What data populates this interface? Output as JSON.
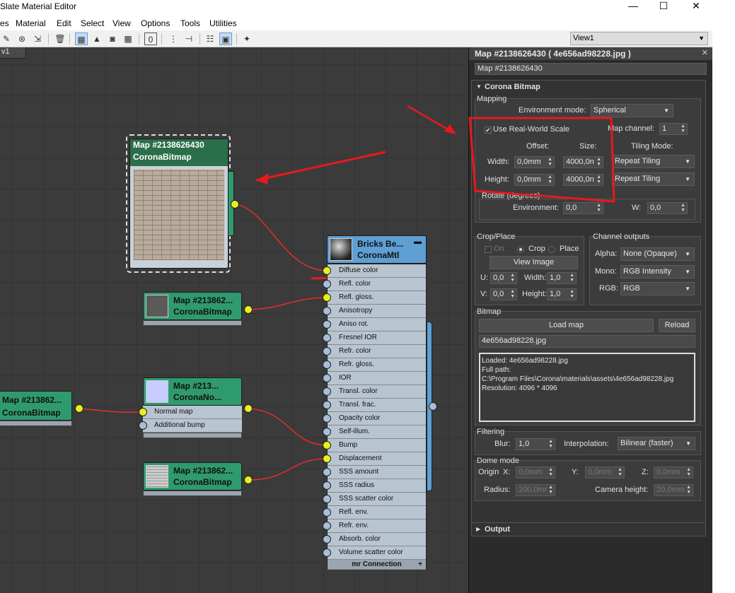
{
  "window": {
    "title": "Slate Material Editor",
    "minimize": "—",
    "maximize": "☐",
    "close": "✕"
  },
  "menu": [
    "es",
    "Material",
    "Edit",
    "Select",
    "View",
    "Options",
    "Tools",
    "Utilities"
  ],
  "toolbar": {
    "view_select": "View1"
  },
  "canvas": {
    "tab": "v1",
    "nodes": {
      "bitmap_main": {
        "title": "Map #2138626430",
        "type": "CoronaBitmap"
      },
      "bitmap_gloss": {
        "title": "Map #213862...",
        "type": "CoronaBitmap"
      },
      "bitmap_left": {
        "title": "Map #213862...",
        "type": "CoronaBitmap"
      },
      "normal": {
        "title": "Map #213...",
        "type": "CoronaNo...",
        "slots": [
          "Normal map",
          "Additional bump"
        ]
      },
      "bitmap_disp": {
        "title": "Map #213862...",
        "type": "CoronaBitmap"
      },
      "mtl": {
        "title": "Bricks Be...",
        "type": "CoronaMtl",
        "slots": [
          "Diffuse color",
          "Refl. color",
          "Refl. gloss.",
          "Anisotropy",
          "Aniso rot.",
          "Fresnel IOR",
          "Refr. color",
          "Refr. gloss.",
          "IOR",
          "Transl. color",
          "Transl. frac.",
          "Opacity color",
          "Self-illum.",
          "Bump",
          "Displacement",
          "SSS amount",
          "SSS radius",
          "SSS scatter color",
          "Refl. env.",
          "Refr. env.",
          "Absorb. color",
          "Volume scatter color"
        ],
        "footer": "mr Connection",
        "footer_plus": "+"
      }
    }
  },
  "panel": {
    "title": "Map #2138626430 ( 4e656ad98228.jpg )",
    "name_field": "Map #2138626430",
    "rollout_title": "Corona Bitmap",
    "mapping": {
      "label": "Mapping",
      "env_mode_label": "Environment mode:",
      "env_mode_value": "Spherical",
      "use_real_world": "Use Real-World Scale",
      "map_channel_label": "Map channel:",
      "map_channel_value": "1",
      "offset_hdr": "Offset:",
      "size_hdr": "Size:",
      "tiling_hdr": "Tiling Mode:",
      "width_label": "Width:",
      "width_offset": "0,0mm",
      "width_size": "4000,0n",
      "width_tiling": "Repeat Tiling",
      "height_label": "Height:",
      "height_offset": "0,0mm",
      "height_size": "4000,0n",
      "height_tiling": "Repeat Tiling",
      "rotate_label": "Rotate (degrees)",
      "environment_label": "Environment:",
      "environment_value": "0,0",
      "w_label": "W:",
      "w_value": "0,0"
    },
    "crop": {
      "label": "Crop/Place",
      "on": "On",
      "crop": "Crop",
      "place": "Place",
      "view_image": "View Image",
      "u_label": "U:",
      "u_value": "0,0",
      "width_label": "Width:",
      "width_value": "1,0",
      "v_label": "V:",
      "v_value": "0,0",
      "height_label": "Height:",
      "height_value": "1,0"
    },
    "channel": {
      "label": "Channel outputs",
      "alpha_label": "Alpha:",
      "alpha_value": "None (Opaque)",
      "mono_label": "Mono:",
      "mono_value": "RGB Intensity",
      "rgb_label": "RGB:",
      "rgb_value": "RGB"
    },
    "bitmap": {
      "label": "Bitmap",
      "load_map": "Load map",
      "reload": "Reload",
      "filename": "4e656ad98228.jpg",
      "info_loaded": "Loaded: 4e656ad98228.jpg",
      "info_fullpath": "Full path:",
      "info_path": "C:\\Program Files\\Corona\\materials\\assets\\4e656ad98228.jpg",
      "info_resolution": "Resolution: 4096 * 4096"
    },
    "filtering": {
      "label": "Filtering",
      "blur_label": "Blur:",
      "blur_value": "1,0",
      "interp_label": "Interpolation:",
      "interp_value": "Bilinear (faster)"
    },
    "dome": {
      "label": "Dome mode",
      "origin_label": "Origin",
      "x_label": "X:",
      "x_value": "0,0mm",
      "y_label": "Y:",
      "y_value": "0,0mm",
      "z_label": "Z:",
      "z_value": "0,0mm",
      "radius_label": "Radius:",
      "radius_value": "200,0mr",
      "cam_label": "Camera height:",
      "cam_value": "20,0mm"
    },
    "output_title": "Output"
  },
  "colors": {
    "canvas_bg": "#3b3b3b",
    "node_green": "#2f9a6e",
    "socket_yellow": "#e5f21d",
    "wire_red": "#ff2a2a",
    "panel_bg": "#2b2b2b",
    "annotation_red": "#e8191c"
  }
}
